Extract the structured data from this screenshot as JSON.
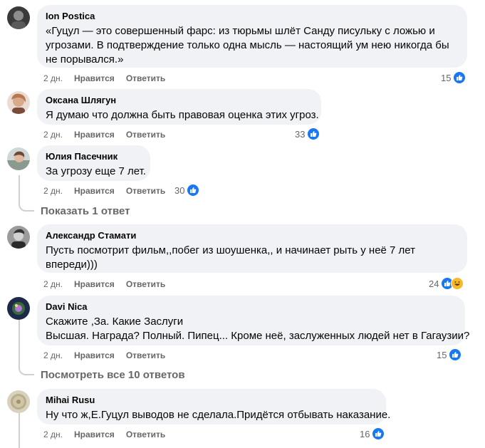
{
  "comments": [
    {
      "author": "Ion Postica",
      "lines": [
        "«Гуцул — это совершенный фарс: из тюрьмы шлёт Санду писульку с ложью и",
        "угрозами. В подтверждение только одна мысль — настоящий ум нею никогда бы",
        "не порывался.»"
      ],
      "time": "2 дн.",
      "like": "Нравится",
      "reply": "Ответить",
      "reactions": "15"
    },
    {
      "author": "Оксана Шлягун",
      "lines": [
        "Я думаю что должна быть правовая оценка этих угроз."
      ],
      "time": "2 дн.",
      "like": "Нравится",
      "reply": "Ответить",
      "reactions": "33"
    },
    {
      "author": "Юлия Пасечник",
      "lines": [
        "За угрозу еще 7 лет."
      ],
      "time": "2 дн.",
      "like": "Нравится",
      "reply": "Ответить",
      "reactions": "30"
    },
    {
      "author": "Александр Стамати",
      "lines": [
        "Пусть посмотрит фильм,,побег из шоушенка,, и начинает рыть у неё 7 лет",
        "впереди)))"
      ],
      "time": "2 дн.",
      "like": "Нравится",
      "reply": "Ответить",
      "reactions": "24"
    },
    {
      "author": "Davi Nica",
      "lines": [
        "Скажите ,За. Какие Заслуги",
        "Высшая. Награда? Полный. Пипец... Кроме неё, заслуженных людей нет в Гагаузии?"
      ],
      "time": "2 дн.",
      "like": "Нравится",
      "reply": "Ответить",
      "reactions": "15"
    },
    {
      "author": "Mihai Rusu",
      "lines": [
        "Ну что ж,Е.Гуцул выводов не сделала.Придётся отбывать наказание."
      ],
      "time": "2 дн.",
      "like": "Нравится",
      "reply": "Ответить",
      "reactions": "16"
    }
  ],
  "show_reply": "Показать 1 ответ",
  "view_all_replies": "Посмотреть все 10 ответов",
  "colors": {
    "like_blue": "#1877f2",
    "bubble": "#f0f2f5",
    "secondary_text": "#65676b",
    "haha_yellow": "#f7b928"
  }
}
